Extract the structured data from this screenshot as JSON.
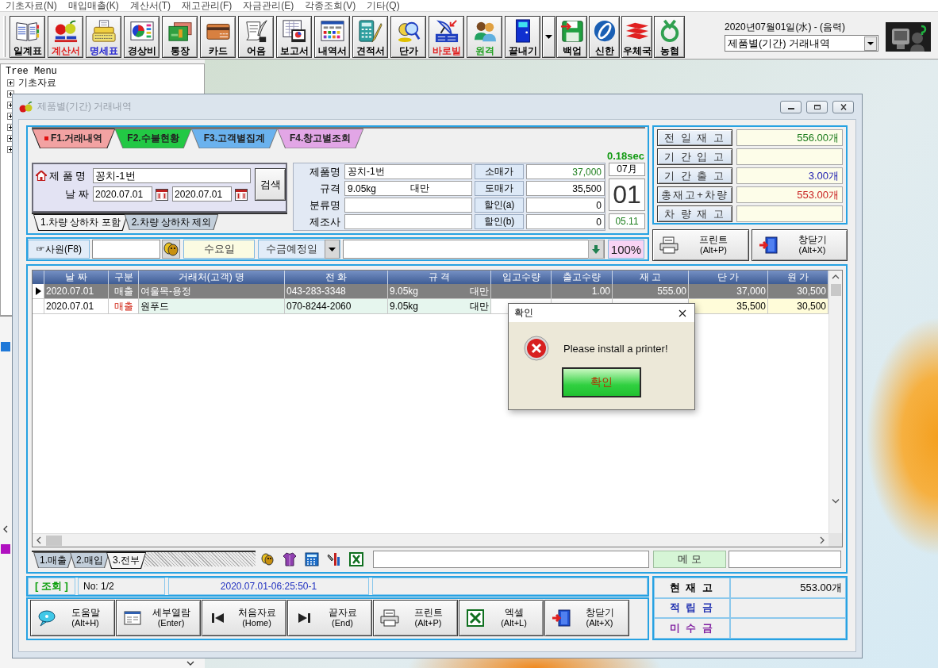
{
  "menu_bar": {
    "items": [
      "기초자료(N)",
      "매입매출(K)",
      "계산서(T)",
      "재고관리(F)",
      "자금관리(E)",
      "각종조회(V)",
      "기타(Q)"
    ]
  },
  "toolbar": {
    "buttons": [
      {
        "label": "일계표",
        "kind": "book"
      },
      {
        "label": "계산서",
        "kind": "apples",
        "color": "#e02020"
      },
      {
        "label": "명세표",
        "kind": "typewriter",
        "color": "#2020d0"
      },
      {
        "label": "경상비",
        "kind": "pie"
      },
      {
        "label": "통장",
        "kind": "bankbook"
      },
      {
        "label": "카드",
        "kind": "card"
      },
      {
        "label": "어음",
        "kind": "scroll"
      },
      {
        "label": "보고서",
        "kind": "report"
      },
      {
        "label": "내역서",
        "kind": "grid"
      },
      {
        "label": "견적서",
        "kind": "calculator"
      },
      {
        "label": "단가",
        "kind": "magnifier"
      },
      {
        "label": "바로빌",
        "kind": "satellite",
        "color": "#e02020"
      },
      {
        "label": "원격",
        "kind": "people",
        "color": "#20a020"
      },
      {
        "label": "끝내기",
        "kind": "door"
      }
    ],
    "extra_buttons": [
      {
        "label": "백업",
        "kind": "floppy"
      },
      {
        "label": "신한",
        "kind": "bank"
      },
      {
        "label": "우체국",
        "kind": "post"
      },
      {
        "label": "농협",
        "kind": "leaf"
      }
    ],
    "date_line": "2020년07월01일(水) - (음력)",
    "view_select": {
      "value": "제품별(기간) 거래내역"
    }
  },
  "tree": {
    "title": "Tree Menu",
    "items": [
      {
        "label": "기초자료",
        "expanded": false
      },
      {
        "expanded": false
      },
      {
        "expanded": false
      },
      {
        "expanded": false
      },
      {
        "expanded": false
      },
      {
        "expanded": false
      },
      {
        "expanded": false
      }
    ]
  },
  "window": {
    "title": "제품별(기간) 거래내역"
  },
  "query": {
    "tabs": [
      {
        "label": "F1.거래내역",
        "selected": true,
        "color": "#f2a2a2"
      },
      {
        "label": "F2.수불현황",
        "selected": false,
        "color": "#22c844"
      },
      {
        "label": "F3.고객별집계",
        "selected": false,
        "color": "#6ab2ee"
      },
      {
        "label": "F4.창고별조회",
        "selected": false,
        "color": "#e2a6e6"
      }
    ],
    "elapsed": "0.18sec",
    "search": {
      "product_label": "제 품 명",
      "product": "꽁치-1번",
      "date_label": "날 짜",
      "date_from": "2020.07.01",
      "date_to": "2020.07.01",
      "button": "검색"
    },
    "load_tabs": [
      {
        "label": "1.차량 상하차 포함",
        "selected": true
      },
      {
        "label": "2.차량 상하차 제외",
        "selected": false
      }
    ],
    "info": [
      {
        "label": "제품명",
        "value": "꽁치-1번",
        "price_label": "소매가",
        "price": "37,000",
        "color": "#208020"
      },
      {
        "label": "규격",
        "value": "9.05kg",
        "origin": "대만",
        "price_label": "도매가",
        "price": "35,500"
      },
      {
        "label": "분류명",
        "price_label": "할인(a)",
        "price": "0"
      },
      {
        "label": "제조사",
        "price_label": "할인(b)",
        "price": "0"
      }
    ],
    "calendar": {
      "month": "07月",
      "day": "01",
      "lunar": "05.11"
    }
  },
  "filter": {
    "staff": "☞사원(F8)",
    "weekday": "수요일",
    "due_select": "수금예정일",
    "percent": "100%"
  },
  "stock": [
    {
      "label": "전 일 재 고",
      "value": "556.00개",
      "color": "#1a7a1a"
    },
    {
      "label": "기 간 입 고"
    },
    {
      "label": "기 간 출 고",
      "value": "3.00개",
      "color": "#2020b0"
    },
    {
      "label": "총재고+차량",
      "value": "553.00개",
      "color": "#c82020"
    },
    {
      "label": "차 량 재 고"
    }
  ],
  "side_buttons": [
    {
      "label": "프린트",
      "hotkey": "(Alt+P)",
      "kind": "printer"
    },
    {
      "label": "창닫기",
      "hotkey": "(Alt+X)",
      "kind": "exit"
    }
  ],
  "table": {
    "columns": [
      "날 짜",
      "구분",
      "거래처(고객) 명",
      "전 화",
      "규 격",
      "입고수량",
      "출고수량",
      "재 고",
      "단 가",
      "원 가"
    ],
    "rows": [
      {
        "selected": true,
        "date": "2020.07.01",
        "type": "매출",
        "customer": "여울목-용정",
        "phone": "043-283-3348",
        "spec": "9.05kg",
        "origin": "대만",
        "out_qty": "1.00",
        "stock": "555.00",
        "price": "37,000",
        "cost": "30,500"
      },
      {
        "selected": false,
        "date": "2020.07.01",
        "type": "매출",
        "color": "#d02010",
        "customer": "원푸드",
        "phone": "070-8244-2060",
        "spec": "9.05kg",
        "origin": "대만",
        "price": "35,500",
        "cost": "30,500"
      }
    ],
    "tabs": [
      {
        "label": "1.매출",
        "selected": false
      },
      {
        "label": "2.매입",
        "selected": false
      },
      {
        "label": "3.전부",
        "selected": true
      }
    ],
    "memo_label": "메 모"
  },
  "status": {
    "mode": "[ 조회 ]",
    "record": "No: 1/2",
    "timestamp": "2020.07.01-06:25:50-1"
  },
  "summary": [
    {
      "label": "현 재 고",
      "value": "553.00개"
    },
    {
      "label": "적 립 금",
      "color": "#2030b0"
    },
    {
      "label": "미 수 금",
      "color": "#8020a0"
    }
  ],
  "bottom_buttons": [
    {
      "label": "도움말",
      "hotkey": "(Alt+H)",
      "kind": "help"
    },
    {
      "label": "세부열람",
      "hotkey": "(Enter)",
      "kind": "detail"
    },
    {
      "label": "처음자료",
      "hotkey": "(Home)",
      "kind": "first"
    },
    {
      "label": "끝자료",
      "hotkey": "(End)",
      "kind": "last"
    },
    {
      "label": "프린트",
      "hotkey": "(Alt+P)",
      "kind": "printer"
    },
    {
      "label": "엑셀",
      "hotkey": "(Alt+L)",
      "kind": "excel"
    },
    {
      "label": "창닫기",
      "hotkey": "(Alt+X)",
      "kind": "exit"
    }
  ],
  "dialog": {
    "title": "확인",
    "message": "Please install a printer!",
    "button": "확인"
  }
}
